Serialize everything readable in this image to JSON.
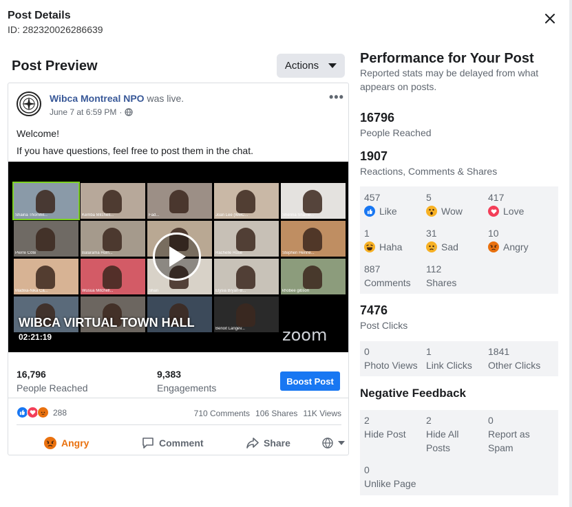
{
  "header": {
    "title": "Post Details",
    "post_id": "ID: 282320026286639"
  },
  "preview": {
    "title": "Post Preview",
    "actions_label": "Actions"
  },
  "post": {
    "page_name": "Wibca Montreal NPO",
    "status": "was live.",
    "time": "June 7 at 6:59 PM",
    "line1": "Welcome!",
    "line2": "If you have questions, feel free to post them in the chat.",
    "video": {
      "title": "WIBCA VIRTUAL TOWN HALL",
      "duration": "02:21:19",
      "brand": "zoom",
      "tiles": [
        {
          "name": "Shaina Thornhil...",
          "bg": "#8a9aa8"
        },
        {
          "name": "Kemba Mitchell...",
          "bg": "#b7a89a"
        },
        {
          "name": "Fad...",
          "bg": "#9c8f86"
        },
        {
          "name": "Joan Lee (WBC...",
          "bg": "#c9b8a6"
        },
        {
          "name": "Sherina Shante...",
          "bg": "#e4e2df"
        },
        {
          "name": "Pierre Côté",
          "bg": "#6f6a64"
        },
        {
          "name": "Balarama Holn...",
          "bg": "#a59a8c"
        },
        {
          "name": "",
          "bg": "#b9a893"
        },
        {
          "name": "Rachelle Rose",
          "bg": "#c7c0b6"
        },
        {
          "name": "Stephen Henne...",
          "bg": "#bf8e62"
        },
        {
          "name": "Madixa-Nika Ca...",
          "bg": "#d7b394"
        },
        {
          "name": "Wusua Mitchell...",
          "bg": "#d35b66"
        },
        {
          "name": "Shari",
          "bg": "#d8d2c8"
        },
        {
          "name": "Elysia Bryan-B...",
          "bg": "#c8c2b8"
        },
        {
          "name": "khobee gibson",
          "bg": "#8c9c7c"
        },
        {
          "name": "",
          "bg": "#5a6a7a"
        },
        {
          "name": "",
          "bg": "#6c6660"
        },
        {
          "name": "",
          "bg": "#3c4a5a"
        },
        {
          "name": "Benoit Langev...",
          "bg": "#2a2a2a"
        }
      ]
    },
    "stats": {
      "reached_value": "16,796",
      "reached_label": "People Reached",
      "engagements_value": "9,383",
      "engagements_label": "Engagements",
      "boost_label": "Boost Post"
    },
    "reaction_count": "288",
    "comments": "710 Comments",
    "shares": "106 Shares",
    "views": "11K Views",
    "actions": {
      "angry": "Angry",
      "comment": "Comment",
      "share": "Share"
    }
  },
  "performance": {
    "title": "Performance for Your Post",
    "subtitle": "Reported stats may be delayed from what appears on posts.",
    "reached_value": "16796",
    "reached_label": "People Reached",
    "rcs_value": "1907",
    "rcs_label": "Reactions, Comments & Shares",
    "reactions": [
      {
        "value": "457",
        "label": "Like",
        "icon": "like-icon",
        "color": "#1877f2"
      },
      {
        "value": "5",
        "label": "Wow",
        "icon": "wow-icon",
        "color": "#f7b125"
      },
      {
        "value": "417",
        "label": "Love",
        "icon": "love-icon",
        "color": "#f33e58"
      },
      {
        "value": "1",
        "label": "Haha",
        "icon": "haha-icon",
        "color": "#f7b125"
      },
      {
        "value": "31",
        "label": "Sad",
        "icon": "sad-icon",
        "color": "#f7b125"
      },
      {
        "value": "10",
        "label": "Angry",
        "icon": "angry-icon",
        "color": "#e9710f"
      },
      {
        "value": "887",
        "label": "Comments"
      },
      {
        "value": "112",
        "label": "Shares"
      }
    ],
    "clicks_value": "7476",
    "clicks_label": "Post Clicks",
    "clicks": [
      {
        "value": "0",
        "label": "Photo Views"
      },
      {
        "value": "1",
        "label": "Link Clicks"
      },
      {
        "value": "1841",
        "label": "Other Clicks"
      }
    ],
    "negative_title": "Negative Feedback",
    "negative": [
      {
        "value": "2",
        "label": "Hide Post"
      },
      {
        "value": "2",
        "label": "Hide All Posts"
      },
      {
        "value": "0",
        "label": "Report as Spam"
      },
      {
        "value": "0",
        "label": "Unlike Page"
      }
    ]
  }
}
